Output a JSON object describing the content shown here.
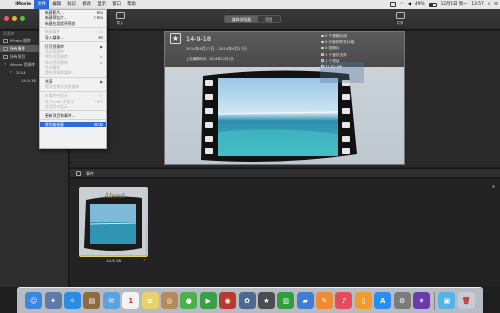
{
  "menubar": {
    "apple_glyph": "",
    "items": [
      "iMovie",
      "文件",
      "编辑",
      "标记",
      "修改",
      "显示",
      "窗口",
      "帮助"
    ],
    "status": {
      "battery": "49%",
      "datetime": "12月1日 周一",
      "time": "13:57"
    }
  },
  "toolbar": {
    "import_label": "导入",
    "share_label": "共享",
    "segments": [
      "媒体浏览器",
      "项目"
    ]
  },
  "file_menu": {
    "items": [
      {
        "label": "新建影片...",
        "shortcut": "⌘N",
        "disabled": false
      },
      {
        "label": "新建预告片...",
        "shortcut": "⇧⌘N",
        "disabled": false
      },
      {
        "label": "新建应用程序预览",
        "shortcut": "",
        "disabled": false
      },
      {
        "sep": true
      },
      {
        "label": "新建事件",
        "shortcut": "⌥N",
        "disabled": true
      },
      {
        "label": "导入媒体...",
        "shortcut": "⌘I",
        "disabled": false
      },
      {
        "sep": true
      },
      {
        "label": "打开资源库",
        "shortcut": "▶",
        "disabled": false
      },
      {
        "label": "关闭资源库",
        "shortcut": "",
        "disabled": true
      },
      {
        "label": "拷贝到资源库",
        "shortcut": "▶",
        "disabled": true
      },
      {
        "label": "移动到资源库",
        "shortcut": "▶",
        "disabled": true
      },
      {
        "label": "合并事件",
        "shortcut": "",
        "disabled": true
      },
      {
        "label": "整合资源库媒体...",
        "shortcut": "",
        "disabled": true
      },
      {
        "sep": true
      },
      {
        "label": "共享",
        "shortcut": "▶",
        "disabled": false
      },
      {
        "label": "将项目拷贝到资源库",
        "shortcut": "",
        "disabled": true
      },
      {
        "sep": true
      },
      {
        "label": "在事件中显示",
        "shortcut": "⇧F",
        "disabled": true
      },
      {
        "label": "在 Finder 中显示",
        "shortcut": "⇧⌘R",
        "disabled": true
      },
      {
        "label": "在项目中显示",
        "shortcut": "",
        "disabled": true
      },
      {
        "sep": true
      },
      {
        "label": "更新项目和事件...",
        "shortcut": "",
        "disabled": false
      },
      {
        "sep": true
      },
      {
        "label": "移到废纸篓",
        "shortcut": "⌘⌫",
        "disabled": false,
        "highlighted": true
      }
    ]
  },
  "sidebar": {
    "heading": "资源库",
    "rows": [
      {
        "label": "iPhoto 图库",
        "selected": false,
        "arrow": ""
      },
      {
        "label": "所有事件",
        "selected": true,
        "arrow": ""
      },
      {
        "label": "所有项目",
        "selected": false,
        "arrow": ""
      },
      {
        "label": "iMovie 资源库",
        "selected": false,
        "arrow": "▾"
      },
      {
        "label": "2014",
        "selected": false,
        "arrow": "▾"
      },
      {
        "label": "14-9-18",
        "selected": false,
        "arrow": ""
      }
    ]
  },
  "event_detail": {
    "title": "14-9-18",
    "date_range": "2014年9月17日 – 2014年9月17日",
    "updated": "上次编辑时间：2014年12月1日",
    "stats": [
      "0 个视频片段",
      "0 分钟的时长片段",
      "0 张照片",
      "1 个音乐文件",
      "1 个项目",
      "31.62 MB"
    ]
  },
  "events_section": {
    "label": "事件",
    "items": [
      {
        "name": "14-9-18",
        "count": "1"
      }
    ]
  },
  "dock": {
    "apps": [
      {
        "name": "Finder",
        "color": "#3b87e0",
        "glyph": "☺"
      },
      {
        "name": "Launchpad",
        "color": "#5f7aa8",
        "glyph": "✦"
      },
      {
        "name": "Safari",
        "color": "#2b8ce6",
        "glyph": "✧"
      },
      {
        "name": "Preview",
        "color": "#8c6b3f",
        "glyph": "▤"
      },
      {
        "name": "Mail",
        "color": "#5aa2e0",
        "glyph": "✉"
      },
      {
        "name": "Calendar",
        "color": "#f3f3f3",
        "glyph": "1"
      },
      {
        "name": "Notes",
        "color": "#e8d36a",
        "glyph": "≡"
      },
      {
        "name": "Contacts",
        "color": "#b68b5c",
        "glyph": "◎"
      },
      {
        "name": "Messages",
        "color": "#4db04a",
        "glyph": "●"
      },
      {
        "name": "FaceTime",
        "color": "#3b9f49",
        "glyph": "▶"
      },
      {
        "name": "Photo Booth",
        "color": "#b8392f",
        "glyph": "◉"
      },
      {
        "name": "iPhoto",
        "color": "#4c6a8f",
        "glyph": "✿"
      },
      {
        "name": "iMovie",
        "color": "#4d4d4d",
        "glyph": "★"
      },
      {
        "name": "Numbers",
        "color": "#2f9e3d",
        "glyph": "▥"
      },
      {
        "name": "Keynote",
        "color": "#3f7ed2",
        "glyph": "▰"
      },
      {
        "name": "Pages",
        "color": "#f08b32",
        "glyph": "✎"
      },
      {
        "name": "iTunes",
        "color": "#e54b5c",
        "glyph": "♪"
      },
      {
        "name": "iBooks",
        "color": "#f29b2d",
        "glyph": "▯"
      },
      {
        "name": "App Store",
        "color": "#2a8cf0",
        "glyph": "A"
      },
      {
        "name": "System Preferences",
        "color": "#7b7b7b",
        "glyph": "⚙"
      },
      {
        "name": "Final Cut",
        "color": "#6b3ba8",
        "glyph": "✶"
      },
      {
        "name": "Downloads",
        "color": "#55b4e6",
        "glyph": "▣"
      },
      {
        "name": "Trash",
        "color": "#c7ccd2",
        "glyph": "🗑"
      }
    ]
  }
}
